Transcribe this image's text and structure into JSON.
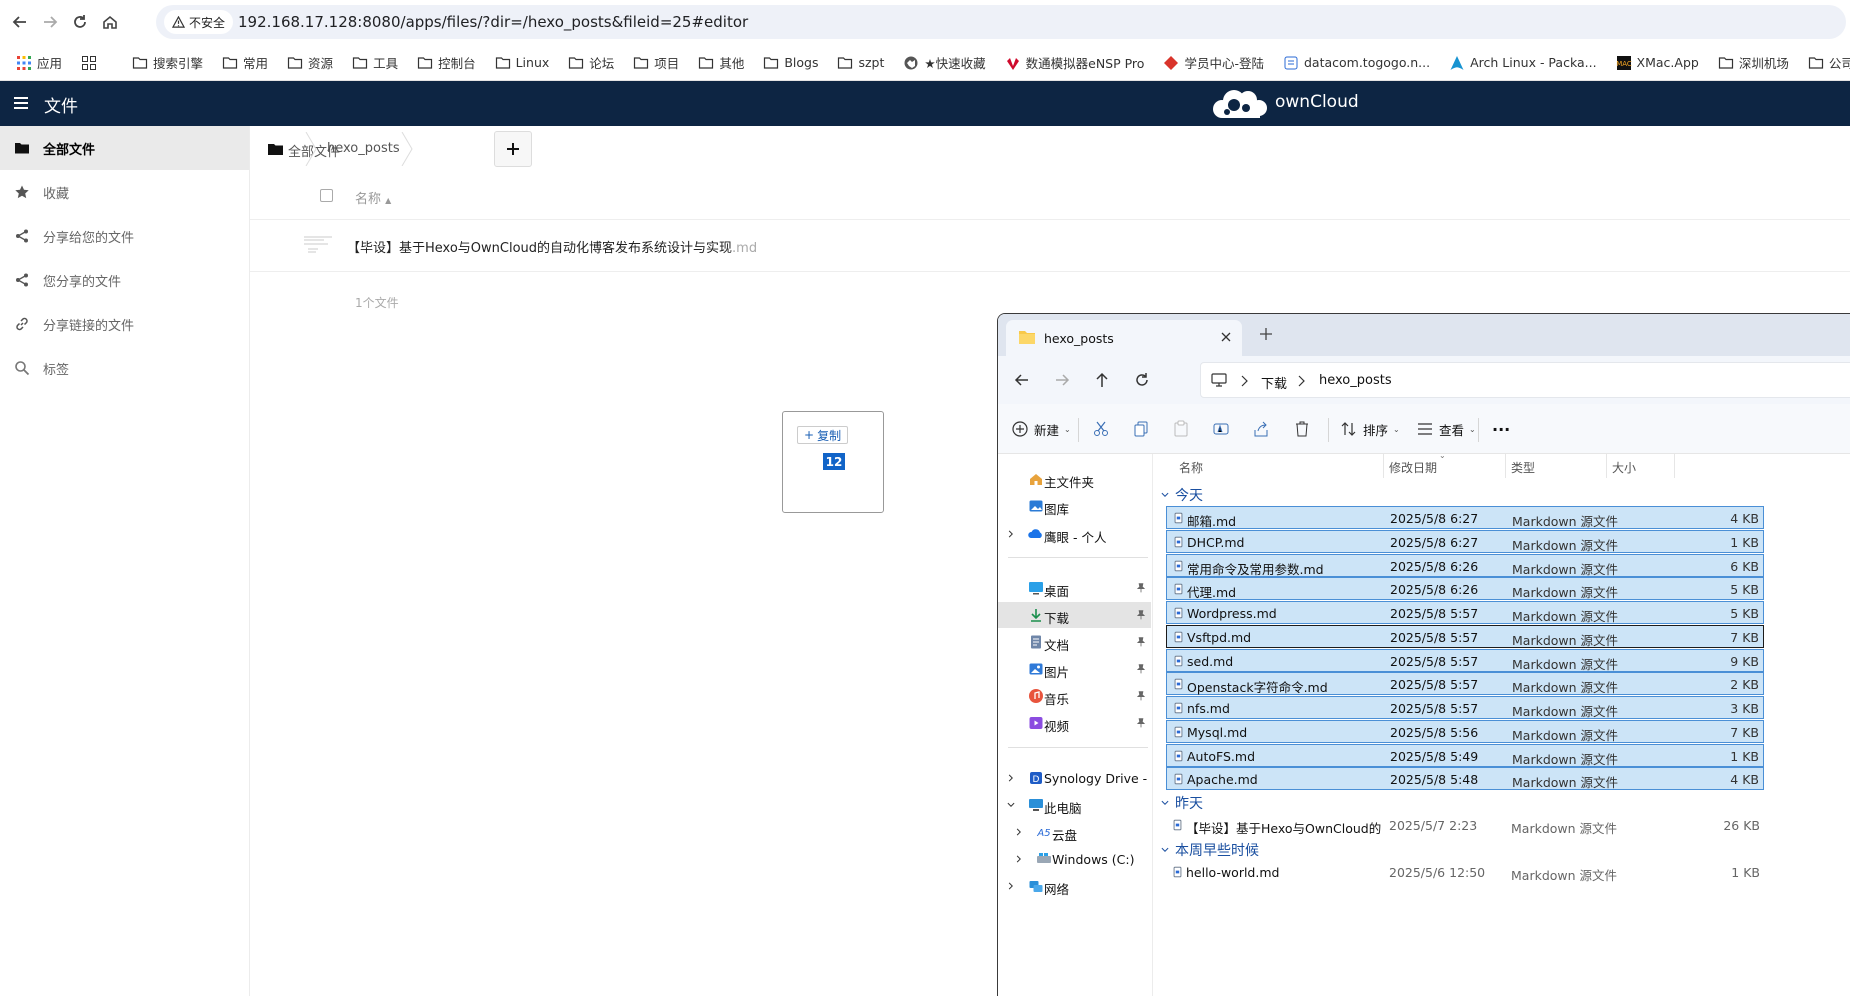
{
  "browser": {
    "security_label": "不安全",
    "url": "192.168.17.128:8080/apps/files/?dir=/hexo_posts&fileid=25#editor",
    "bookmarks": [
      {
        "label": "应用",
        "icon": "apps-grid-icon"
      },
      {
        "label": "",
        "icon": "tab-groups-icon"
      },
      {
        "label": "搜索引擎",
        "icon": "folder-icon"
      },
      {
        "label": "常用",
        "icon": "folder-icon"
      },
      {
        "label": "资源",
        "icon": "folder-icon"
      },
      {
        "label": "工具",
        "icon": "folder-icon"
      },
      {
        "label": "控制台",
        "icon": "folder-icon"
      },
      {
        "label": "Linux",
        "icon": "folder-icon"
      },
      {
        "label": "论坛",
        "icon": "folder-icon"
      },
      {
        "label": "项目",
        "icon": "folder-icon"
      },
      {
        "label": "其他",
        "icon": "folder-icon"
      },
      {
        "label": "Blogs",
        "icon": "folder-icon"
      },
      {
        "label": "szpt",
        "icon": "folder-icon"
      },
      {
        "label": "★快速收藏",
        "icon": "globe-icon"
      },
      {
        "label": "数通模拟器eNSP Pro",
        "icon": "huawei-icon"
      },
      {
        "label": "学员中心-登陆",
        "icon": "diamond-icon"
      },
      {
        "label": "datacom.togogo.n...",
        "icon": "page-icon"
      },
      {
        "label": "Arch Linux - Packa...",
        "icon": "arch-icon"
      },
      {
        "label": "XMac.App",
        "icon": "xmac-icon"
      },
      {
        "label": "深圳机场",
        "icon": "folder-icon"
      },
      {
        "label": "公司",
        "icon": "folder-icon"
      }
    ]
  },
  "owncloud": {
    "app_title": "文件",
    "brand": "ownCloud",
    "sidebar": [
      {
        "label": "全部文件",
        "icon": "folder-icon",
        "active": true
      },
      {
        "label": "收藏",
        "icon": "star-icon",
        "active": false
      },
      {
        "label": "分享给您的文件",
        "icon": "share-icon",
        "active": false
      },
      {
        "label": "您分享的文件",
        "icon": "share-icon",
        "active": false
      },
      {
        "label": "分享链接的文件",
        "icon": "link-icon",
        "active": false
      },
      {
        "label": "标签",
        "icon": "search-icon",
        "active": false
      }
    ],
    "breadcrumb": {
      "root": "全部文件",
      "current": "hexo_posts"
    },
    "column_name": "名称",
    "files": [
      {
        "name": "【毕设】基于Hexo与OwnCloud的自动化博客发布系统设计与实现",
        "ext": ".md"
      }
    ],
    "summary": "1个文件",
    "drag": {
      "action": "复制",
      "count": "12"
    }
  },
  "explorer": {
    "tab_title": "hexo_posts",
    "path": [
      "下载",
      "hexo_posts"
    ],
    "commands": {
      "new": "新建",
      "sort": "排序",
      "view": "查看"
    },
    "nav": [
      {
        "label": "主文件夹",
        "icon": "home-icon",
        "indent": 1,
        "chev": false,
        "pin": false
      },
      {
        "label": "图库",
        "icon": "gallery-icon",
        "indent": 1,
        "chev": false,
        "pin": false
      },
      {
        "label": "鹰眼 - 个人",
        "icon": "onedrive-icon",
        "indent": 1,
        "chev": true,
        "pin": false
      },
      {
        "label": "桌面",
        "icon": "desktop-icon",
        "indent": 1,
        "chev": false,
        "pin": true
      },
      {
        "label": "下载",
        "icon": "download-icon",
        "indent": 1,
        "chev": false,
        "pin": true,
        "selected": true
      },
      {
        "label": "文档",
        "icon": "document-icon",
        "indent": 1,
        "chev": false,
        "pin": true
      },
      {
        "label": "图片",
        "icon": "pictures-icon",
        "indent": 1,
        "chev": false,
        "pin": true
      },
      {
        "label": "音乐",
        "icon": "music-icon",
        "indent": 1,
        "chev": false,
        "pin": true
      },
      {
        "label": "视频",
        "icon": "video-icon",
        "indent": 1,
        "chev": false,
        "pin": true
      },
      {
        "label": "Synology Drive -",
        "icon": "synology-icon",
        "indent": 1,
        "chev": true,
        "pin": false
      },
      {
        "label": "此电脑",
        "icon": "computer-icon",
        "indent": 1,
        "chev": true,
        "expanded": true,
        "pin": false
      },
      {
        "label": "云盘",
        "icon": "cloud-drive-icon",
        "indent": 2,
        "chev": true,
        "pin": false
      },
      {
        "label": "Windows (C:)",
        "icon": "drive-icon",
        "indent": 2,
        "chev": true,
        "pin": false
      },
      {
        "label": "网络",
        "icon": "network-icon",
        "indent": 1,
        "chev": true,
        "pin": false
      }
    ],
    "columns": {
      "name": "名称",
      "modified": "修改日期",
      "type": "类型",
      "size": "大小"
    },
    "groups": [
      {
        "title": "今天",
        "files": [
          {
            "name": "邮箱.md",
            "modified": "2025/5/8 6:27",
            "type": "Markdown 源文件",
            "size": "4 KB",
            "state": "sel"
          },
          {
            "name": "DHCP.md",
            "modified": "2025/5/8 6:27",
            "type": "Markdown 源文件",
            "size": "1 KB",
            "state": "sel"
          },
          {
            "name": "常用命令及常用参数.md",
            "modified": "2025/5/8 6:26",
            "type": "Markdown 源文件",
            "size": "6 KB",
            "state": "sel"
          },
          {
            "name": "代理.md",
            "modified": "2025/5/8 6:26",
            "type": "Markdown 源文件",
            "size": "5 KB",
            "state": "sel"
          },
          {
            "name": "Wordpress.md",
            "modified": "2025/5/8 5:57",
            "type": "Markdown 源文件",
            "size": "5 KB",
            "state": "sel"
          },
          {
            "name": "Vsftpd.md",
            "modified": "2025/5/8 5:57",
            "type": "Markdown 源文件",
            "size": "7 KB",
            "state": "focus"
          },
          {
            "name": "sed.md",
            "modified": "2025/5/8 5:57",
            "type": "Markdown 源文件",
            "size": "9 KB",
            "state": "sel"
          },
          {
            "name": "Openstack字符命令.md",
            "modified": "2025/5/8 5:57",
            "type": "Markdown 源文件",
            "size": "2 KB",
            "state": "sel"
          },
          {
            "name": "nfs.md",
            "modified": "2025/5/8 5:57",
            "type": "Markdown 源文件",
            "size": "3 KB",
            "state": "sel"
          },
          {
            "name": "Mysql.md",
            "modified": "2025/5/8 5:56",
            "type": "Markdown 源文件",
            "size": "7 KB",
            "state": "sel"
          },
          {
            "name": "AutoFS.md",
            "modified": "2025/5/8 5:49",
            "type": "Markdown 源文件",
            "size": "1 KB",
            "state": "sel"
          },
          {
            "name": "Apache.md",
            "modified": "2025/5/8 5:48",
            "type": "Markdown 源文件",
            "size": "4 KB",
            "state": "sel"
          }
        ]
      },
      {
        "title": "昨天",
        "files": [
          {
            "name": "【毕设】基于Hexo与OwnCloud的自动...",
            "modified": "2025/5/7 2:23",
            "type": "Markdown 源文件",
            "size": "26 KB",
            "state": "plain"
          }
        ]
      },
      {
        "title": "本周早些时候",
        "files": [
          {
            "name": "hello-world.md",
            "modified": "2025/5/6 12:50",
            "type": "Markdown 源文件",
            "size": "1 KB",
            "state": "plain"
          }
        ]
      }
    ]
  },
  "colors": {
    "oc_header": "#0d2543",
    "selection": "#cce4f7",
    "selection_border": "#4a8fd6",
    "group_title": "#1a4fa0",
    "drag_badge": "#1164c8"
  }
}
